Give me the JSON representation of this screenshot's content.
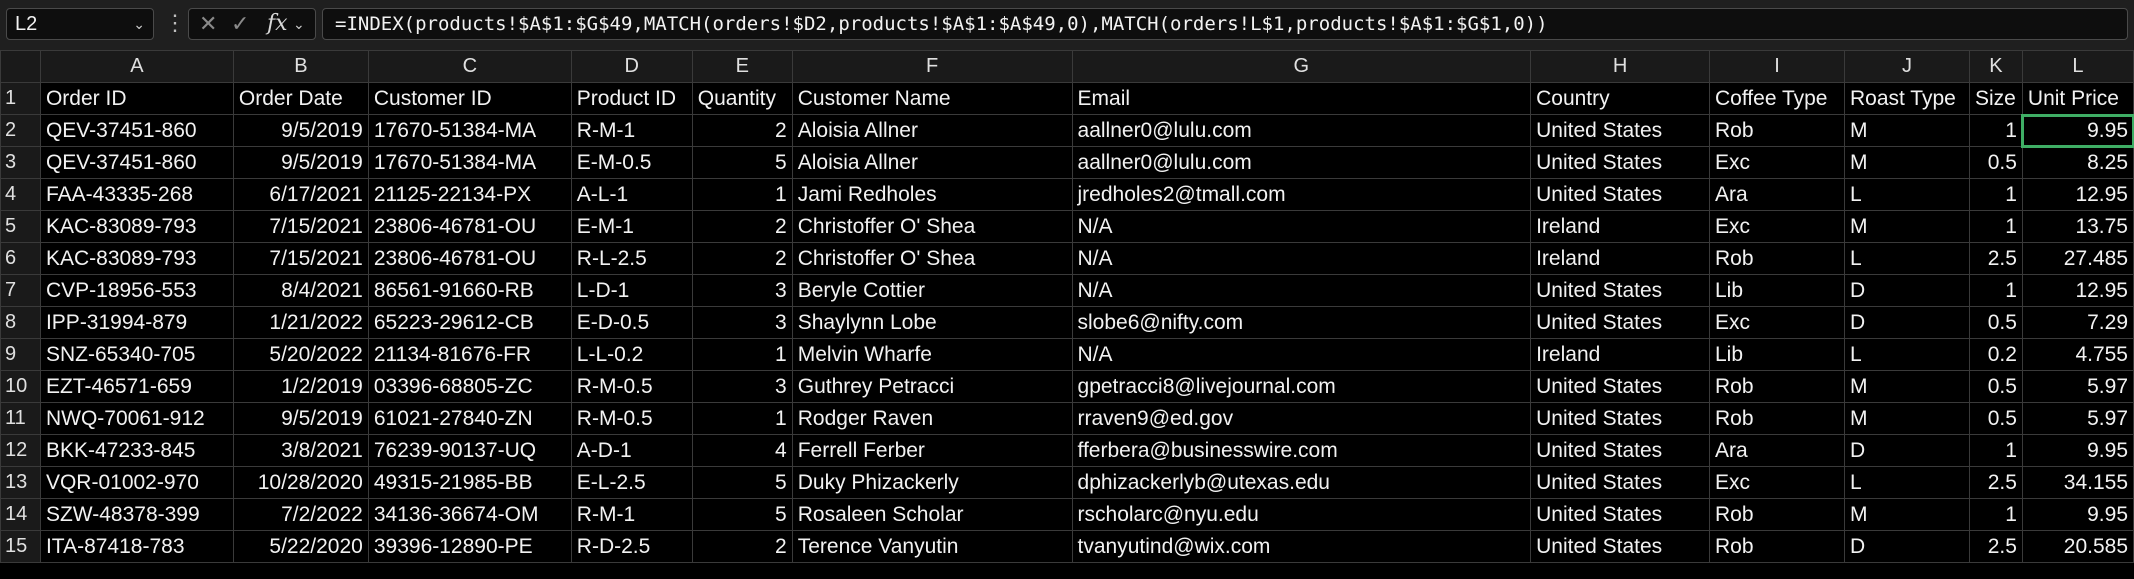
{
  "name_box": "L2",
  "formula": "=INDEX(products!$A$1:$G$49,MATCH(orders!$D2,products!$A$1:$A$49,0),MATCH(orders!L$1,products!$A$1:$G$1,0))",
  "columns": [
    "A",
    "B",
    "C",
    "D",
    "E",
    "F",
    "G",
    "H",
    "I",
    "J",
    "K",
    "L"
  ],
  "header_row": [
    "Order ID",
    "Order Date",
    "Customer ID",
    "Product ID",
    "Quantity",
    "Customer Name",
    "Email",
    "Country",
    "Coffee Type",
    "Roast Type",
    "Size",
    "Unit Price"
  ],
  "rows": [
    [
      "QEV-37451-860",
      "9/5/2019",
      "17670-51384-MA",
      "R-M-1",
      "2",
      "Aloisia Allner",
      "aallner0@lulu.com",
      "United States",
      "Rob",
      "M",
      "1",
      "9.95"
    ],
    [
      "QEV-37451-860",
      "9/5/2019",
      "17670-51384-MA",
      "E-M-0.5",
      "5",
      "Aloisia Allner",
      "aallner0@lulu.com",
      "United States",
      "Exc",
      "M",
      "0.5",
      "8.25"
    ],
    [
      "FAA-43335-268",
      "6/17/2021",
      "21125-22134-PX",
      "A-L-1",
      "1",
      "Jami Redholes",
      "jredholes2@tmall.com",
      "United States",
      "Ara",
      "L",
      "1",
      "12.95"
    ],
    [
      "KAC-83089-793",
      "7/15/2021",
      "23806-46781-OU",
      "E-M-1",
      "2",
      "Christoffer O' Shea",
      "N/A",
      "Ireland",
      "Exc",
      "M",
      "1",
      "13.75"
    ],
    [
      "KAC-83089-793",
      "7/15/2021",
      "23806-46781-OU",
      "R-L-2.5",
      "2",
      "Christoffer O' Shea",
      "N/A",
      "Ireland",
      "Rob",
      "L",
      "2.5",
      "27.485"
    ],
    [
      "CVP-18956-553",
      "8/4/2021",
      "86561-91660-RB",
      "L-D-1",
      "3",
      "Beryle Cottier",
      "N/A",
      "United States",
      "Lib",
      "D",
      "1",
      "12.95"
    ],
    [
      "IPP-31994-879",
      "1/21/2022",
      "65223-29612-CB",
      "E-D-0.5",
      "3",
      "Shaylynn Lobe",
      "slobe6@nifty.com",
      "United States",
      "Exc",
      "D",
      "0.5",
      "7.29"
    ],
    [
      "SNZ-65340-705",
      "5/20/2022",
      "21134-81676-FR",
      "L-L-0.2",
      "1",
      "Melvin Wharfe",
      "N/A",
      "Ireland",
      "Lib",
      "L",
      "0.2",
      "4.755"
    ],
    [
      "EZT-46571-659",
      "1/2/2019",
      "03396-68805-ZC",
      "R-M-0.5",
      "3",
      "Guthrey Petracci",
      "gpetracci8@livejournal.com",
      "United States",
      "Rob",
      "M",
      "0.5",
      "5.97"
    ],
    [
      "NWQ-70061-912",
      "9/5/2019",
      "61021-27840-ZN",
      "R-M-0.5",
      "1",
      "Rodger Raven",
      "rraven9@ed.gov",
      "United States",
      "Rob",
      "M",
      "0.5",
      "5.97"
    ],
    [
      "BKK-47233-845",
      "3/8/2021",
      "76239-90137-UQ",
      "A-D-1",
      "4",
      "Ferrell Ferber",
      "fferbera@businesswire.com",
      "United States",
      "Ara",
      "D",
      "1",
      "9.95"
    ],
    [
      "VQR-01002-970",
      "10/28/2020",
      "49315-21985-BB",
      "E-L-2.5",
      "5",
      "Duky Phizackerly",
      "dphizackerlyb@utexas.edu",
      "United States",
      "Exc",
      "L",
      "2.5",
      "34.155"
    ],
    [
      "SZW-48378-399",
      "7/2/2022",
      "34136-36674-OM",
      "R-M-1",
      "5",
      "Rosaleen Scholar",
      "rscholarc@nyu.edu",
      "United States",
      "Rob",
      "M",
      "1",
      "9.95"
    ],
    [
      "ITA-87418-783",
      "5/22/2020",
      "39396-12890-PE",
      "R-D-2.5",
      "2",
      "Terence Vanyutin",
      "tvanyutind@wix.com",
      "United States",
      "Rob",
      "D",
      "2.5",
      "20.585"
    ]
  ]
}
